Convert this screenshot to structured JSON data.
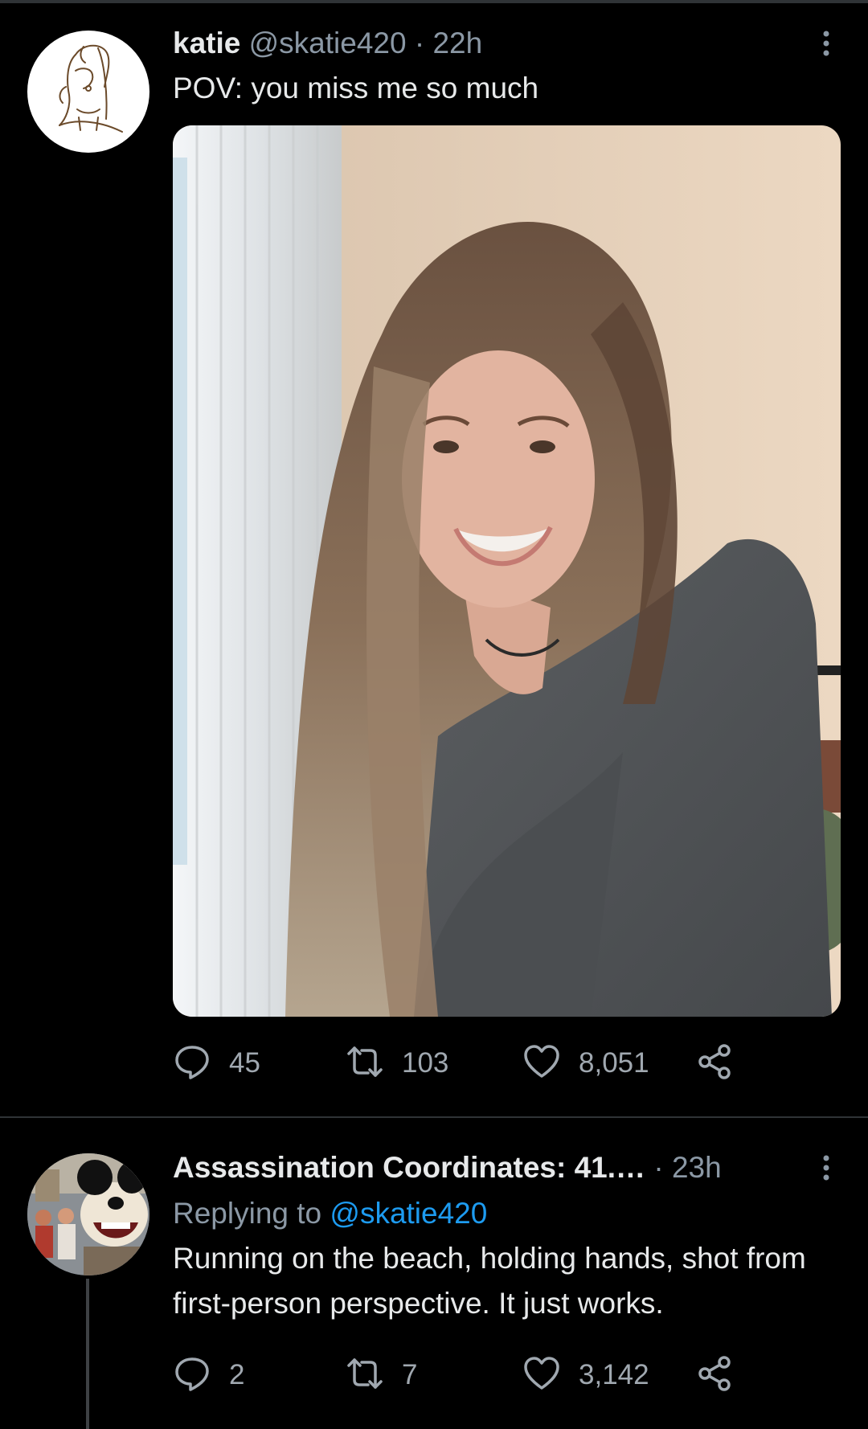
{
  "tweets": [
    {
      "display_name": "katie",
      "handle": "@skatie420",
      "separator": "·",
      "time": "22h",
      "text": "POV: you miss me so much",
      "counts": {
        "replies": "45",
        "retweets": "103",
        "likes": "8,051"
      }
    },
    {
      "display_name": "Assassination Coordinates: 41.…",
      "separator": "·",
      "time": "23h",
      "replying_prefix": "Replying to",
      "replying_handle": "@skatie420",
      "text": "Running on the beach, holding hands, shot from first-person perspective. It just works.",
      "counts": {
        "replies": "2",
        "retweets": "7",
        "likes": "3,142"
      }
    }
  ],
  "icons": {
    "reply": "reply-icon",
    "retweet": "retweet-icon",
    "like": "heart-icon",
    "share": "share-icon",
    "more": "more-options-icon"
  },
  "colors": {
    "background": "#000000",
    "text": "#e7e9ea",
    "muted": "#8b98a5",
    "link": "#1d9bf0",
    "divider": "#2f3336"
  }
}
